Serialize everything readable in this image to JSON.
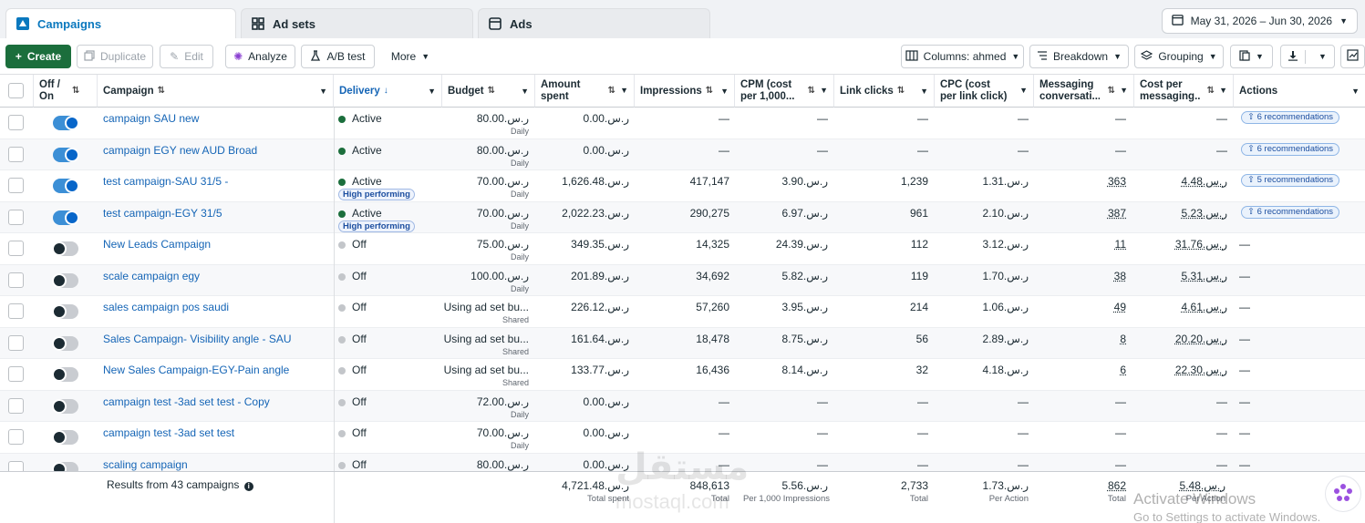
{
  "tabs": [
    {
      "label": "Campaigns",
      "active": true,
      "icon": "campaigns-icon"
    },
    {
      "label": "Ad sets",
      "active": false,
      "icon": "grid-icon"
    },
    {
      "label": "Ads",
      "active": false,
      "icon": "ad-icon"
    }
  ],
  "date_range": "May 31, 2026 – Jun 30, 2026",
  "toolbar": {
    "create": "Create",
    "duplicate": "Duplicate",
    "edit": "Edit",
    "analyze": "Analyze",
    "ab_test": "A/B test",
    "more": "More",
    "columns": "Columns: ahmed",
    "breakdown": "Breakdown",
    "grouping": "Grouping"
  },
  "columns": {
    "off_on": "Off / On",
    "campaign": "Campaign",
    "delivery": "Delivery",
    "budget": "Budget",
    "amount_spent": "Amount spent",
    "impressions": "Impressions",
    "cpm": "CPM (cost per 1,000...",
    "link_clicks": "Link clicks",
    "cpc": "CPC (cost per link click)",
    "messaging": "Messaging conversati...",
    "cost_per_messaging": "Cost per messaging...",
    "actions": "Actions"
  },
  "rows": [
    {
      "on": true,
      "name": "campaign SAU new",
      "delivery": "Active",
      "high_performing": false,
      "budget": "ر.س.80.00",
      "budget_sub": "Daily",
      "spent": "ر.س.0.00",
      "impressions": "—",
      "cpm": "—",
      "clicks": "—",
      "cpc": "—",
      "messaging": "—",
      "cost_msg": "—",
      "actions": "6 recommendations"
    },
    {
      "on": true,
      "name": "campaign EGY new AUD Broad",
      "delivery": "Active",
      "high_performing": false,
      "budget": "ر.س.80.00",
      "budget_sub": "Daily",
      "spent": "ر.س.0.00",
      "impressions": "—",
      "cpm": "—",
      "clicks": "—",
      "cpc": "—",
      "messaging": "—",
      "cost_msg": "—",
      "actions": "6 recommendations"
    },
    {
      "on": true,
      "name": "test campaign-SAU 31/5 -",
      "delivery": "Active",
      "high_performing": true,
      "budget": "ر.س.70.00",
      "budget_sub": "Daily",
      "spent": "ر.س.1,626.48",
      "impressions": "417,147",
      "cpm": "ر.س.3.90",
      "clicks": "1,239",
      "cpc": "ر.س.1.31",
      "messaging": "363",
      "cost_msg": "ر.س.4.48",
      "actions": "5 recommendations"
    },
    {
      "on": true,
      "name": "test campaign-EGY 31/5",
      "delivery": "Active",
      "high_performing": true,
      "budget": "ر.س.70.00",
      "budget_sub": "Daily",
      "spent": "ر.س.2,022.23",
      "impressions": "290,275",
      "cpm": "ر.س.6.97",
      "clicks": "961",
      "cpc": "ر.س.2.10",
      "messaging": "387",
      "cost_msg": "ر.س.5.23",
      "actions": "6 recommendations"
    },
    {
      "on": false,
      "name": "New Leads Campaign",
      "delivery": "Off",
      "high_performing": false,
      "budget": "ر.س.75.00",
      "budget_sub": "Daily",
      "spent": "ر.س.349.35",
      "impressions": "14,325",
      "cpm": "ر.س.24.39",
      "clicks": "112",
      "cpc": "ر.س.3.12",
      "messaging": "11",
      "cost_msg": "ر.س.31.76",
      "actions": "—"
    },
    {
      "on": false,
      "name": "scale campaign egy",
      "delivery": "Off",
      "high_performing": false,
      "budget": "ر.س.100.00",
      "budget_sub": "Daily",
      "spent": "ر.س.201.89",
      "impressions": "34,692",
      "cpm": "ر.س.5.82",
      "clicks": "119",
      "cpc": "ر.س.1.70",
      "messaging": "38",
      "cost_msg": "ر.س.5.31",
      "actions": "—"
    },
    {
      "on": false,
      "name": "sales campaign pos saudi",
      "delivery": "Off",
      "high_performing": false,
      "budget": "Using ad set bu...",
      "budget_sub": "Shared",
      "spent": "ر.س.226.12",
      "impressions": "57,260",
      "cpm": "ر.س.3.95",
      "clicks": "214",
      "cpc": "ر.س.1.06",
      "messaging": "49",
      "cost_msg": "ر.س.4.61",
      "actions": "—"
    },
    {
      "on": false,
      "name": "Sales Campaign- Visibility angle - SAU",
      "delivery": "Off",
      "high_performing": false,
      "budget": "Using ad set bu...",
      "budget_sub": "Shared",
      "spent": "ر.س.161.64",
      "impressions": "18,478",
      "cpm": "ر.س.8.75",
      "clicks": "56",
      "cpc": "ر.س.2.89",
      "messaging": "8",
      "cost_msg": "ر.س.20.20",
      "actions": "—"
    },
    {
      "on": false,
      "name": "New Sales Campaign-EGY-Pain angle",
      "delivery": "Off",
      "high_performing": false,
      "budget": "Using ad set bu...",
      "budget_sub": "Shared",
      "spent": "ر.س.133.77",
      "impressions": "16,436",
      "cpm": "ر.س.8.14",
      "clicks": "32",
      "cpc": "ر.س.4.18",
      "messaging": "6",
      "cost_msg": "ر.س.22.30",
      "actions": "—"
    },
    {
      "on": false,
      "name": "campaign test -3ad set test - Copy",
      "delivery": "Off",
      "high_performing": false,
      "budget": "ر.س.72.00",
      "budget_sub": "Daily",
      "spent": "ر.س.0.00",
      "impressions": "—",
      "cpm": "—",
      "clicks": "—",
      "cpc": "—",
      "messaging": "—",
      "cost_msg": "—",
      "actions": "—"
    },
    {
      "on": false,
      "name": "campaign test -3ad set test",
      "delivery": "Off",
      "high_performing": false,
      "budget": "ر.س.70.00",
      "budget_sub": "Daily",
      "spent": "ر.س.0.00",
      "impressions": "—",
      "cpm": "—",
      "clicks": "—",
      "cpc": "—",
      "messaging": "—",
      "cost_msg": "—",
      "actions": "—"
    },
    {
      "on": false,
      "name": "scaling campaign",
      "delivery": "Off",
      "high_performing": false,
      "budget": "ر.س.80.00",
      "budget_sub": "",
      "spent": "ر.س.0.00",
      "impressions": "—",
      "cpm": "—",
      "clicks": "—",
      "cpc": "—",
      "messaging": "—",
      "cost_msg": "—",
      "actions": "—"
    }
  ],
  "high_performing_label": "High performing",
  "footer": {
    "results": "Results from 43 campaigns",
    "spent": "ر.س.4,721.48",
    "spent_sub": "Total spent",
    "impressions": "848,613",
    "impressions_sub": "Total",
    "cpm": "ر.س.5.56",
    "cpm_sub": "Per 1,000 Impressions",
    "clicks": "2,733",
    "clicks_sub": "Total",
    "cpc": "ر.س.1.73",
    "cpc_sub": "Per Action",
    "messaging": "862",
    "messaging_sub": "Total",
    "cost_msg": "ر.س.5.48",
    "cost_msg_sub": "Per Action"
  },
  "watermark": "مستقل",
  "watermark_url": "mostaql.com",
  "os_notice": "Activate Windows",
  "os_notice_sub": "Go to Settings to activate Windows.",
  "colors": {
    "primary_green": "#1b6e3c",
    "link_blue": "#1565b6",
    "toggle_blue": "#0866c9"
  }
}
